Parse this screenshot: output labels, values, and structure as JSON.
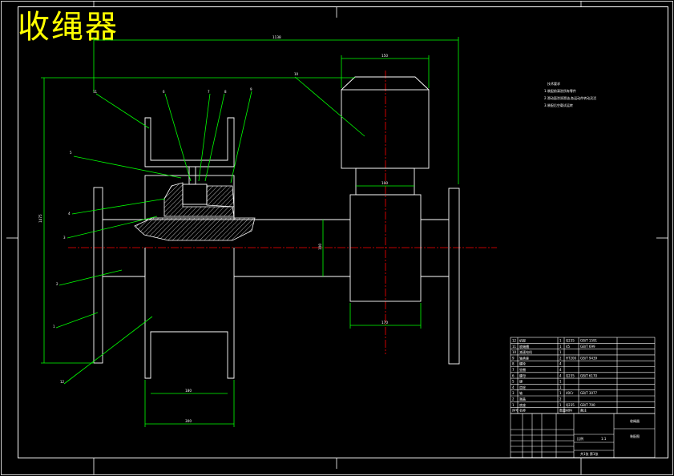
{
  "title": "收绳器",
  "colors": {
    "background": "#000000",
    "outline": "#ffffff",
    "dimension": "#00ff00",
    "centerline": "#ff0000",
    "title": "#ffff00"
  },
  "dimensions": {
    "overall_width": "1138",
    "top_motor_width": "150",
    "shaft_width": "100",
    "lower_block_width": "170",
    "left_box_inner": "180",
    "left_box_outer": "300",
    "left_height": "1475",
    "center_height": "100"
  },
  "part_labels": [
    "11",
    "6",
    "7",
    "8",
    "9",
    "5",
    "4",
    "3",
    "2",
    "1",
    "12",
    "10"
  ],
  "tech_notes": [
    "技术要求",
    "1.装配前清洗所有零件",
    "2.滑动面涂润滑油,各运动件转动灵活",
    "3.装配后空载试运转"
  ],
  "parts_table": {
    "rows": [
      [
        "12",
        "机架",
        "1",
        "Q235",
        "GB/T 1591"
      ],
      [
        "11",
        "收绳槽",
        "1",
        "45",
        "GB/T 699"
      ],
      [
        "10",
        "减速电机",
        "1",
        "",
        ""
      ],
      [
        "9",
        "轴承座",
        "2",
        "HT200",
        "GB/T 9439"
      ],
      [
        "8",
        "螺栓",
        "4",
        "",
        ""
      ],
      [
        "7",
        "垫圈",
        "4",
        "",
        ""
      ],
      [
        "6",
        "螺母",
        "4",
        "Q235",
        "GB/T 6170"
      ],
      [
        "5",
        "键",
        "1",
        "",
        ""
      ],
      [
        "4",
        "齿轮",
        "1",
        "",
        ""
      ],
      [
        "3",
        "轴",
        "1",
        "40Cr",
        "GB/T 3077"
      ],
      [
        "2",
        "端盖",
        "2",
        "",
        ""
      ],
      [
        "1",
        "底座",
        "1",
        "Q235",
        "GB/T 700"
      ]
    ],
    "header": [
      "序号",
      "名称",
      "数量",
      "材料",
      "备注"
    ]
  },
  "title_block": {
    "drawing_name": "收绳器",
    "assembly": "装配图",
    "scale_label": "比例",
    "scale": "1:1",
    "sheet": "共1张 第1张"
  }
}
